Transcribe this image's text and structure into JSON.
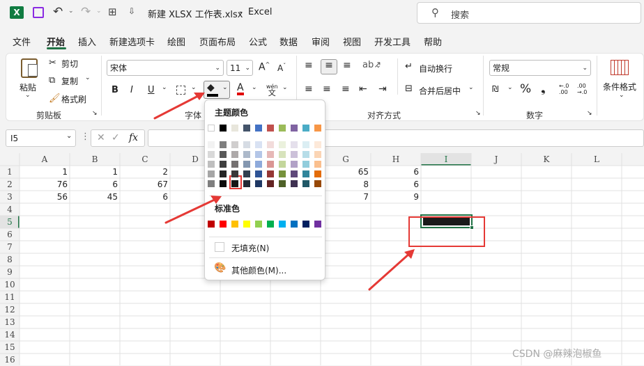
{
  "titlebar": {
    "filename": "新建 XLSX 工作表.xlsx",
    "sep": "-",
    "app": "Excel",
    "search_placeholder": "搜索"
  },
  "tabs": [
    "文件",
    "开始",
    "插入",
    "新建选项卡",
    "绘图",
    "页面布局",
    "公式",
    "数据",
    "审阅",
    "视图",
    "开发工具",
    "帮助"
  ],
  "ribbon": {
    "paste": "粘贴",
    "cut": "剪切",
    "copy": "复制",
    "format_painter": "格式刷",
    "clipboard": "剪贴板",
    "font_name": "宋体",
    "font_size": "11",
    "bold": "B",
    "italic": "I",
    "underline": "U",
    "font_group": "字体",
    "wen": "wén",
    "wen2": "文",
    "wrap_text": "自动换行",
    "merge_center": "合并后居中",
    "alignment": "对齐方式",
    "number_format": "常规",
    "percent": "%",
    "comma": "❟",
    "dec_inc": "←.0\n.00",
    "number": "数字",
    "cond_format": "条件格式"
  },
  "formula_bar": {
    "name_box": "I5",
    "fx": "fx",
    "value": ""
  },
  "columns": [
    "A",
    "B",
    "C",
    "D",
    "E",
    "F",
    "G",
    "H",
    "I",
    "J",
    "K",
    "L"
  ],
  "rows": [
    "1",
    "2",
    "3",
    "4",
    "5",
    "6",
    "7",
    "8",
    "9",
    "10",
    "11",
    "12",
    "13",
    "14",
    "15",
    "16"
  ],
  "cells": {
    "r1": {
      "A": "1",
      "B": "1",
      "C": "2",
      "G": "65",
      "H": "6"
    },
    "r2": {
      "A": "76",
      "B": "6",
      "C": "67",
      "G": "8",
      "H": "6"
    },
    "r3": {
      "A": "56",
      "B": "45",
      "C": "6",
      "G": "7",
      "H": "9"
    }
  },
  "color_popup": {
    "theme_colors_label": "主题颜色",
    "standard_colors_label": "标准色",
    "no_fill": "无填充(N)",
    "more_colors": "其他颜色(M)...",
    "theme_colors": [
      "#ffffff",
      "#000000",
      "#e8e6dc",
      "#44546a",
      "#4472c4",
      "#c0504d",
      "#9bbb59",
      "#8064a2",
      "#4bacc6",
      "#f79646"
    ],
    "theme_shades": [
      [
        "#f2f2f2",
        "#7f7f7f",
        "#d0cece",
        "#d6dce4",
        "#d9e2f3",
        "#f2dcdb",
        "#ebf1dd",
        "#e5e0ec",
        "#dbeef3",
        "#fde9d9"
      ],
      [
        "#d9d9d9",
        "#595959",
        "#aeaaaa",
        "#adb9ca",
        "#b4c6e7",
        "#e6b8b7",
        "#d7e3bc",
        "#ccc1d9",
        "#b7dde8",
        "#fbd5b5"
      ],
      [
        "#bfbfbf",
        "#3f3f3f",
        "#757171",
        "#8497b0",
        "#8eaadb",
        "#da9694",
        "#c3d69b",
        "#b2a2c7",
        "#92cddc",
        "#fac08f"
      ],
      [
        "#a6a6a6",
        "#262626",
        "#3a3838",
        "#323f4f",
        "#2f5496",
        "#953734",
        "#76923c",
        "#5f497a",
        "#31859b",
        "#e36c09"
      ],
      [
        "#7f7f7f",
        "#0c0c0c",
        "#171616",
        "#222a35",
        "#1f3864",
        "#632423",
        "#4f6128",
        "#3f3151",
        "#205867",
        "#974806"
      ]
    ],
    "standard_colors": [
      "#c00000",
      "#ff0000",
      "#ffc000",
      "#ffff00",
      "#92d050",
      "#00b050",
      "#00b0f0",
      "#0070c0",
      "#002060",
      "#7030a0"
    ]
  },
  "watermark": "CSDN @麻辣泡椒鱼",
  "accent": "#217346",
  "highlight": "#e53935"
}
